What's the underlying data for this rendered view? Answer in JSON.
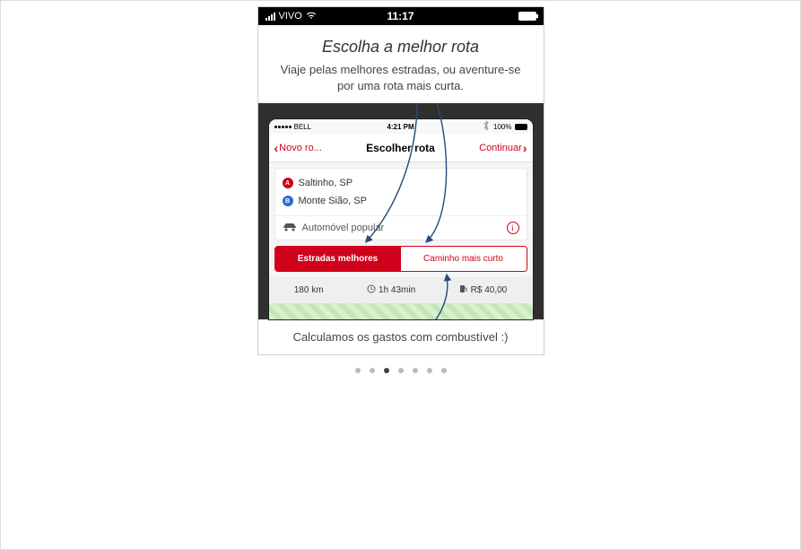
{
  "outer_status": {
    "carrier": "VIVO",
    "time": "11:17"
  },
  "onboarding": {
    "title": "Escolha a melhor rota",
    "subtitle": "Viaje pelas melhores estradas, ou aventure-se por uma rota mais curta.",
    "footer": "Calculamos os gastos com combustível :)"
  },
  "inner_status": {
    "carrier": "BELL",
    "time": "4:21 PM",
    "battery": "100%"
  },
  "navbar": {
    "back_label": "Novo ro...",
    "title": "Escolher rota",
    "continue_label": "Continuar"
  },
  "route": {
    "points": [
      {
        "badge": "A",
        "name": "Saltinho, SP"
      },
      {
        "badge": "B",
        "name": "Monte Sião, SP"
      }
    ],
    "vehicle_label": "Automóvel popular"
  },
  "toggle": {
    "best_roads": "Estradas melhores",
    "shortest": "Caminho mais curto"
  },
  "stats": {
    "distance": "180 km",
    "time": "1h 43min",
    "fuel_cost": "R$ 40,00"
  },
  "pager": {
    "count": 7,
    "active_index": 2
  },
  "icons": {
    "wifi": "wifi-icon",
    "battery": "battery-icon",
    "bluetooth": "bluetooth-icon",
    "car": "car-icon",
    "clock": "clock-icon",
    "fuel": "fuel-pump-icon",
    "info": "info-icon"
  }
}
